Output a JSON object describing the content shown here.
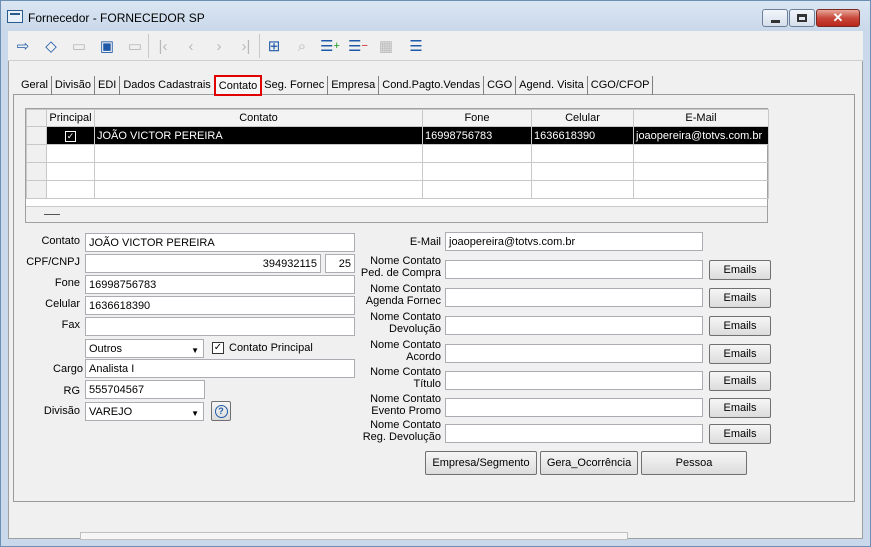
{
  "window": {
    "title": "Fornecedor - FORNECEDOR SP"
  },
  "toolbar": {
    "icons": [
      "exit-icon",
      "eraser-icon",
      "new-record-icon",
      "edit-record-icon",
      "delete-record-icon",
      "first-icon",
      "previous-icon",
      "next-icon",
      "last-icon",
      "grid-view-icon",
      "search-icon",
      "add-item-icon",
      "remove-item-icon",
      "table-icon",
      "list-icon"
    ]
  },
  "tabs": [
    "Geral",
    "Divisão",
    "EDI",
    "Dados Cadastrais",
    "Contato",
    "Seg. Fornec",
    "Empresa",
    "Cond.Pagto.Vendas",
    "CGO",
    "Agend. Visita",
    "CGO/CFOP"
  ],
  "grid": {
    "headers": [
      "Principal",
      "Contato",
      "Fone",
      "Celular",
      "E-Mail"
    ],
    "rows": [
      {
        "principal": "✓",
        "contato": "JOÃO VICTOR PEREIRA",
        "fone": "16998756783",
        "celular": "1636618390",
        "email": "joaopereira@totvs.com.br"
      }
    ]
  },
  "form": {
    "contato_label": "Contato",
    "contato_value": "JOÃO VICTOR PEREIRA",
    "cpf_label": "CPF/CNPJ",
    "cpf_value": "394932115",
    "cpf_digit": "25",
    "fone_label": "Fone",
    "fone_value": "16998756783",
    "celular_label": "Celular",
    "celular_value": "1636618390",
    "fax_label": "Fax",
    "fax_value": "",
    "tipo_value": "Outros",
    "principal_label": "Contato Principal",
    "cargo_label": "Cargo",
    "cargo_value": "Analista I",
    "rg_label": "RG",
    "rg_value": "555704567",
    "divisao_label": "Divisão",
    "divisao_value": "VAREJO",
    "email_label": "E-Mail",
    "email_value": "joaopereira@totvs.com.br",
    "right_fields": [
      {
        "l1": "Nome Contato",
        "l2": "Ped. de Compra",
        "btn": "Emails"
      },
      {
        "l1": "Nome Contato",
        "l2": "Agenda Fornec",
        "btn": "Emails"
      },
      {
        "l1": "Nome Contato",
        "l2": "Devolução",
        "btn": "Emails"
      },
      {
        "l1": "Nome Contato",
        "l2": "Acordo",
        "btn": "Emails"
      },
      {
        "l1": "Nome Contato",
        "l2": "Título",
        "btn": "Emails"
      },
      {
        "l1": "Nome Contato",
        "l2": "Evento Promo",
        "btn": "Emails"
      },
      {
        "l1": "Nome Contato",
        "l2": "Reg. Devolução",
        "btn": "Emails"
      }
    ],
    "buttons": {
      "empresa": "Empresa/Segmento",
      "ocorrencia": "Gera_Ocorrência",
      "pessoa": "Pessoa"
    }
  }
}
